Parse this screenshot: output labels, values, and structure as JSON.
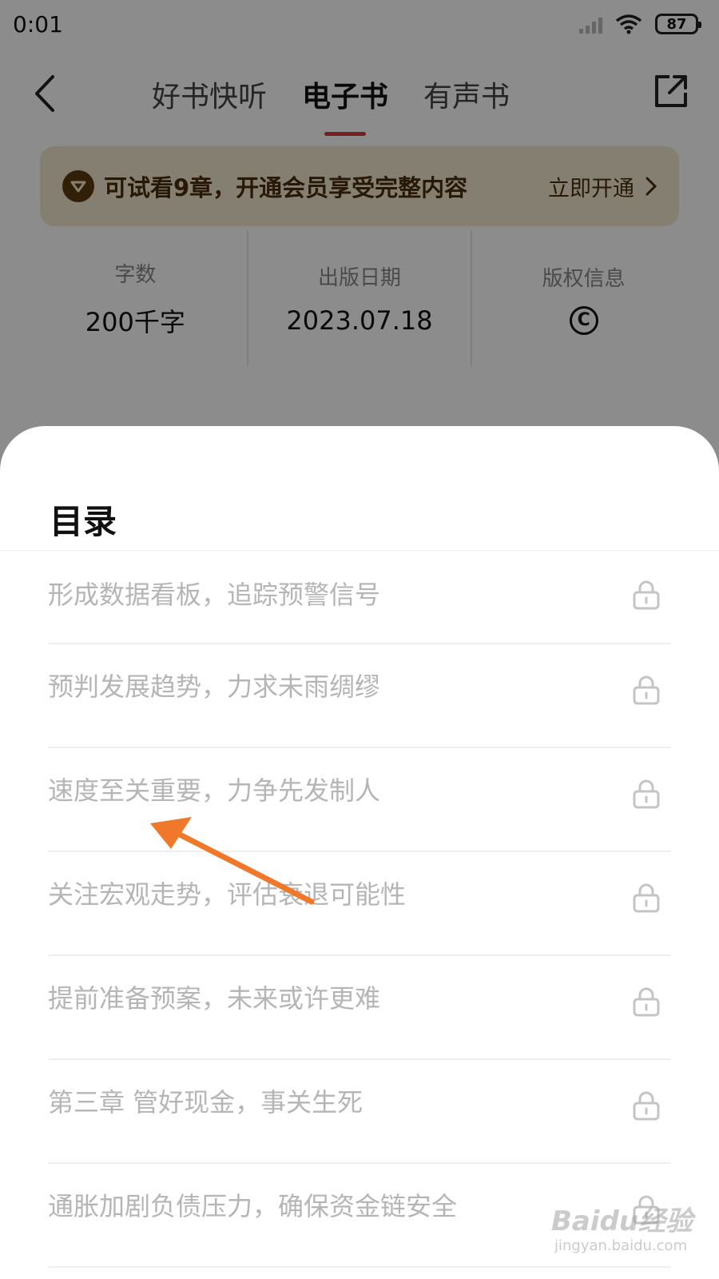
{
  "status_bar": {
    "time": "0:01",
    "battery": "87"
  },
  "nav": {
    "tabs": [
      {
        "label": "好书快听",
        "active": false
      },
      {
        "label": "电子书",
        "active": true
      },
      {
        "label": "有声书",
        "active": false
      }
    ]
  },
  "vip_banner": {
    "text": "可试看9章，开通会员享受完整内容",
    "action": "立即开通"
  },
  "info": [
    {
      "label": "字数",
      "value": "200千字"
    },
    {
      "label": "出版日期",
      "value": "2023.07.18"
    },
    {
      "label": "版权信息",
      "value": ""
    }
  ],
  "sheet": {
    "title": "目录",
    "items": [
      "形成数据看板，追踪预警信号",
      "预判发展趋势，力求未雨绸缪",
      "速度至关重要，力争先发制人",
      "关注宏观走势，评估衰退可能性",
      "提前准备预案，未来或许更难",
      "第三章 管好现金，事关生死",
      "通胀加剧负债压力，确保资金链安全"
    ]
  },
  "colors": {
    "accent": "#d23b3b",
    "arrow": "#f0782a",
    "vip_bg": "#f3e7cf"
  },
  "watermark": {
    "text": "Baidu经验",
    "sub": "jingyan.baidu.com"
  }
}
